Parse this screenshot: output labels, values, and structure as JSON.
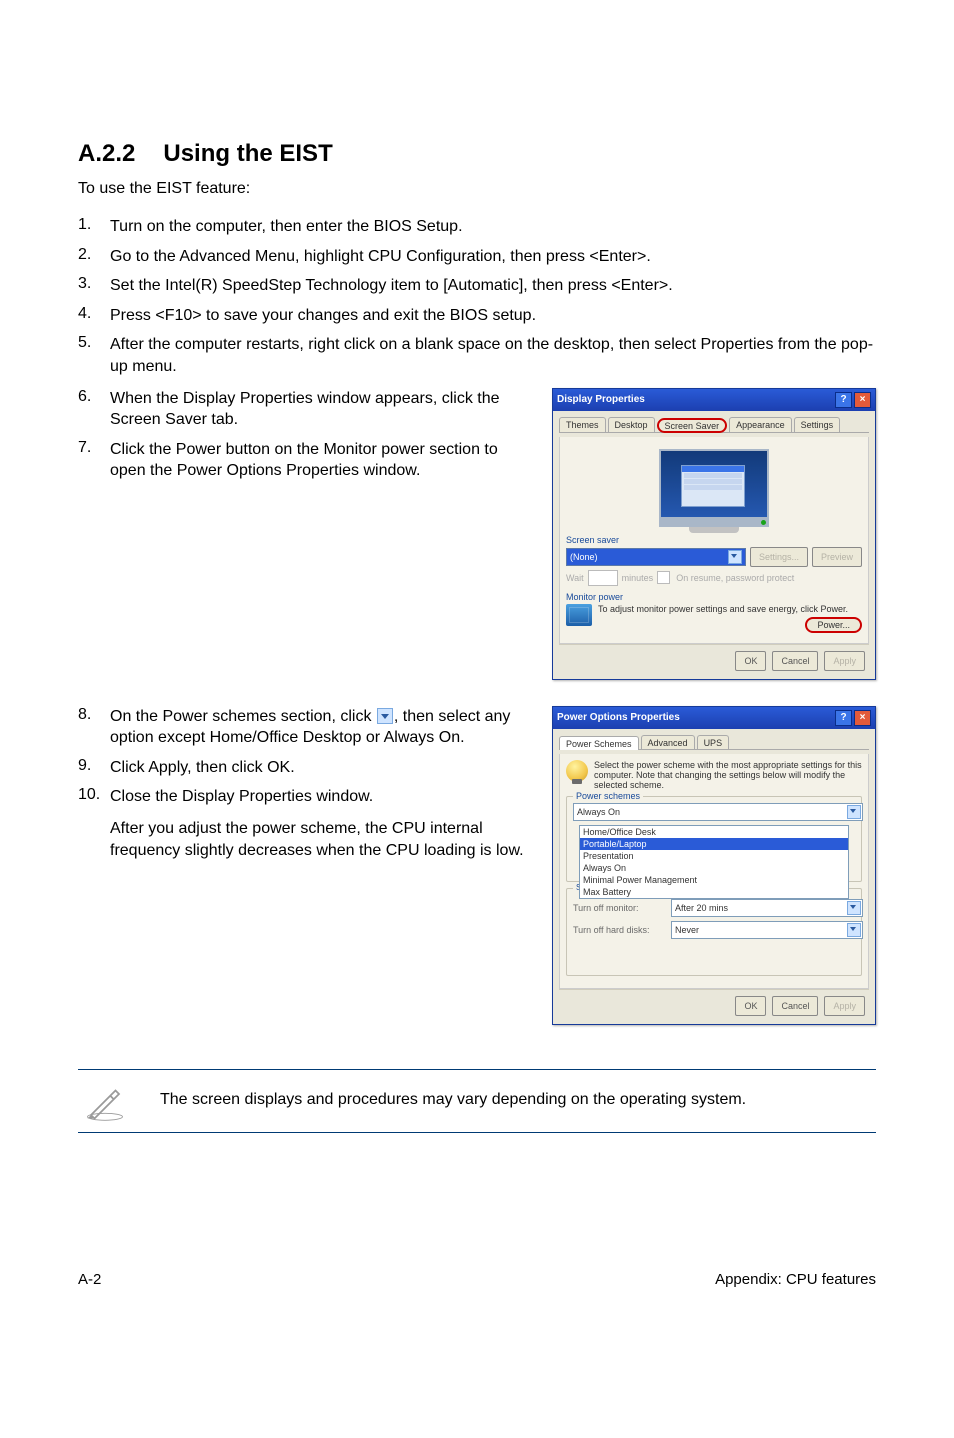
{
  "heading": {
    "number": "A.2.2",
    "title": "Using the EIST"
  },
  "intro": "To use the EIST feature:",
  "steps": [
    "Turn on the computer, then enter the BIOS Setup.",
    "Go to the Advanced Menu, highlight CPU Configuration, then press <Enter>.",
    "Set the Intel(R) SpeedStep Technology item to [Automatic], then press <Enter>.",
    "Press <F10> to save your changes and exit the BIOS setup.",
    "After the computer restarts, right click on a blank space on the desktop, then select Properties from the pop-up menu.",
    "When the Display Properties window appears, click the Screen Saver tab.",
    "Click the Power button on the Monitor power section to open the Power Options Properties window.",
    "On the Power schemes section, click",
    ", then select any option except Home/Office Desktop or Always On.",
    "Click Apply, then click OK.",
    "Close the Display Properties window."
  ],
  "after_para": "After you adjust the power scheme, the CPU internal frequency slightly decreases when the CPU loading is low.",
  "note": "The screen displays and procedures may vary depending on the operating system.",
  "footer": {
    "left": "A-2",
    "right": "Appendix: CPU features"
  },
  "display_props": {
    "title": "Display Properties",
    "tabs": [
      "Themes",
      "Desktop",
      "Screen Saver",
      "Appearance",
      "Settings"
    ],
    "screensaver_label": "Screen saver",
    "ss_value": "(None)",
    "settings_btn": "Settings...",
    "preview_btn": "Preview",
    "wait_label": "Wait",
    "wait_unit": "minutes",
    "resume_label": "On resume, password protect",
    "monitor_power_label": "Monitor power",
    "monitor_power_text": "To adjust monitor power settings and save energy, click Power.",
    "power_btn": "Power...",
    "ok": "OK",
    "cancel": "Cancel",
    "apply": "Apply"
  },
  "power_options": {
    "title": "Power Options Properties",
    "tabs": [
      "Power Schemes",
      "Advanced",
      "UPS"
    ],
    "desc": "Select the power scheme with the most appropriate settings for this computer. Note that changing the settings below will modify the selected scheme.",
    "group_label": "Power schemes",
    "selected": "Always On",
    "list": [
      "Home/Office Desk",
      "Portable/Laptop",
      "Presentation",
      "Always On",
      "Minimal Power Management",
      "Max Battery"
    ],
    "highlight_index": 1,
    "settings_label": "Settings for Always On power scheme",
    "monitor_label": "Turn off monitor:",
    "monitor_val": "After 20 mins",
    "disks_label": "Turn off hard disks:",
    "disks_val": "Never",
    "ok": "OK",
    "cancel": "Cancel",
    "apply": "Apply"
  }
}
